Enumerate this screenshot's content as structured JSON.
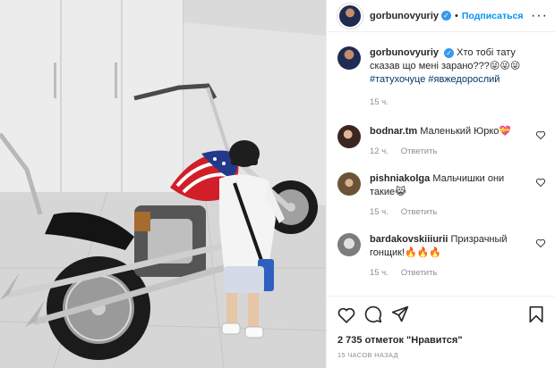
{
  "post": {
    "author": "gorbunovyuriy",
    "follow_label": "Подписаться",
    "more_label": "···",
    "caption": "Хто тобі тату сказав що мені зарано???😜😜😜",
    "hashtags": "#татухочуце #явжедорослий",
    "caption_time": "15 ч."
  },
  "comments": [
    {
      "user": "bodnar.tm",
      "text": "Маленький Юрко💝",
      "time": "12 ч.",
      "reply": "Ответить"
    },
    {
      "user": "pishniakolga",
      "text": "Мальчишки они такие😹",
      "time": "15 ч.",
      "reply": "Ответить"
    },
    {
      "user": "bardakovskiiiurii",
      "text": "Призрачный гонщик!🔥🔥🔥",
      "time": "15 ч.",
      "reply": "Ответить"
    }
  ],
  "footer": {
    "likes": "2 735 отметок \"Нравится\"",
    "ago": "15 часов назад"
  },
  "icons": {
    "like": "heart-icon",
    "comment": "comment-icon",
    "share": "share-icon",
    "save": "bookmark-icon",
    "verified": "verified-badge-icon"
  },
  "colors": {
    "accent": "#0095f6",
    "verified": "#3897f0",
    "hashtag": "#00376b",
    "muted": "#8e8e8e"
  }
}
